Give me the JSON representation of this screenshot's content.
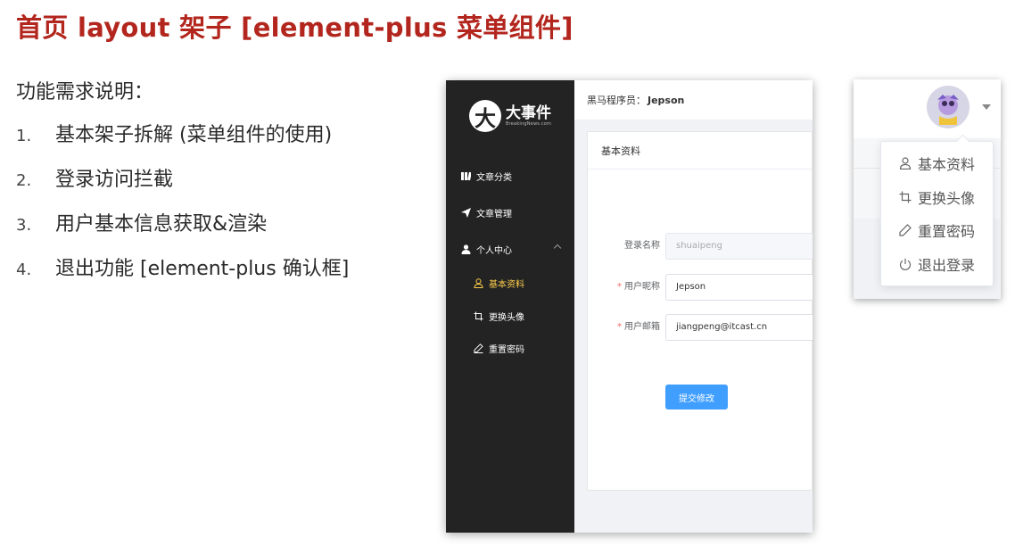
{
  "slide": {
    "title": "首页 layout 架子 [element-plus 菜单组件]",
    "intro": "功能需求说明：",
    "requirements": [
      {
        "num": "1.",
        "text": "基本架子拆解 (菜单组件的使用)"
      },
      {
        "num": "2.",
        "text": "登录访问拦截"
      },
      {
        "num": "3.",
        "text": "用户基本信息获取&渲染"
      },
      {
        "num": "4.",
        "text": "退出功能 [element-plus 确认框]"
      }
    ]
  },
  "app": {
    "logo": {
      "mark": "大",
      "name": "大事件",
      "subtitle": "BreakingNews.com"
    },
    "menu": [
      {
        "label": "文章分类",
        "icon": "category-icon"
      },
      {
        "label": "文章管理",
        "icon": "paper-plane-icon"
      },
      {
        "label": "个人中心",
        "icon": "user-icon",
        "expanded": true
      }
    ],
    "submenu": [
      {
        "label": "基本资料",
        "icon": "user-outline-icon",
        "active": true
      },
      {
        "label": "更换头像",
        "icon": "crop-icon"
      },
      {
        "label": "重置密码",
        "icon": "edit-pen-icon"
      }
    ],
    "header": {
      "prefix": "黑马程序员：",
      "username": "Jepson"
    },
    "card": {
      "title": "基本资料",
      "fields": [
        {
          "label": "登录名称",
          "required": false,
          "value": "shuaipeng",
          "disabled": true
        },
        {
          "label": "用户昵称",
          "required": true,
          "value": "Jepson",
          "disabled": false
        },
        {
          "label": "用户邮箱",
          "required": true,
          "value": "jiangpeng@itcast.cn",
          "disabled": false
        }
      ],
      "required_mark": "*",
      "submit_label": "提交修改"
    },
    "colors": {
      "sidebar": "#232323",
      "active": "#ffd04b",
      "primary": "#409eff"
    }
  },
  "dropdown": {
    "items": [
      {
        "label": "基本资料",
        "icon": "user-outline-icon"
      },
      {
        "label": "更换头像",
        "icon": "crop-icon"
      },
      {
        "label": "重置密码",
        "icon": "edit-pen-icon"
      },
      {
        "label": "退出登录",
        "icon": "power-icon"
      }
    ]
  }
}
